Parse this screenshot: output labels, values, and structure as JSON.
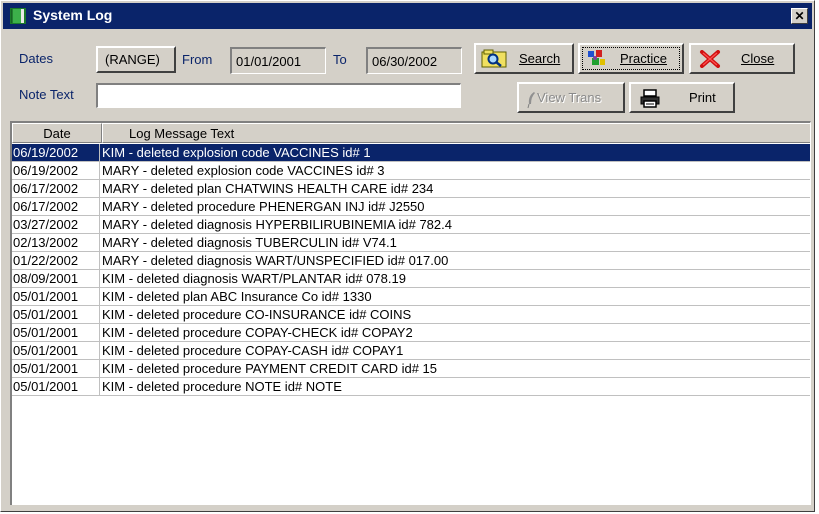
{
  "window": {
    "title": "System Log",
    "close_glyph": "✕",
    "title_icon": "book-icon"
  },
  "filters": {
    "dates_label": "Dates",
    "range_button": "(RANGE)",
    "from_label": "From",
    "from_value": "01/01/2001",
    "to_label": "To",
    "to_value": "06/30/2002",
    "note_label": "Note Text",
    "note_value": ""
  },
  "buttons": {
    "search": {
      "label": "Search",
      "icon": "search-icon"
    },
    "practice": {
      "label": "Practice",
      "icon": "practice-icon"
    },
    "close": {
      "label": "Close",
      "icon": "close-x-icon"
    },
    "view_trans": {
      "label": "View Trans",
      "icon": "quill-icon",
      "disabled": true
    },
    "print": {
      "label": "Print",
      "icon": "printer-icon"
    }
  },
  "log": {
    "columns": [
      "Date",
      "Log Message Text"
    ],
    "selected_index": 0,
    "rows": [
      {
        "date": "06/19/2002",
        "text": "KIM - deleted explosion code VACCINES id# 1"
      },
      {
        "date": "06/19/2002",
        "text": "MARY - deleted explosion code VACCINES id# 3"
      },
      {
        "date": "06/17/2002",
        "text": "MARY - deleted plan CHATWINS HEALTH CARE id# 234"
      },
      {
        "date": "06/17/2002",
        "text": "MARY - deleted procedure PHENERGAN INJ id# J2550"
      },
      {
        "date": "03/27/2002",
        "text": "MARY - deleted diagnosis HYPERBILIRUBINEMIA id# 782.4"
      },
      {
        "date": "02/13/2002",
        "text": "MARY - deleted diagnosis TUBERCULIN id# V74.1"
      },
      {
        "date": "01/22/2002",
        "text": "MARY - deleted diagnosis WART/UNSPECIFIED id# 017.00"
      },
      {
        "date": "08/09/2001",
        "text": "KIM - deleted diagnosis WART/PLANTAR id# 078.19"
      },
      {
        "date": "05/01/2001",
        "text": "KIM - deleted plan ABC Insurance Co id# 1330"
      },
      {
        "date": "05/01/2001",
        "text": "KIM - deleted procedure CO-INSURANCE id# COINS"
      },
      {
        "date": "05/01/2001",
        "text": "KIM - deleted procedure COPAY-CHECK id# COPAY2"
      },
      {
        "date": "05/01/2001",
        "text": "KIM - deleted procedure COPAY-CASH id# COPAY1"
      },
      {
        "date": "05/01/2001",
        "text": "KIM - deleted procedure PAYMENT CREDIT CARD id# 15"
      },
      {
        "date": "05/01/2001",
        "text": "KIM - deleted procedure NOTE id# NOTE"
      }
    ]
  },
  "colors": {
    "title_bar": "#0a246a",
    "face": "#d4d0c8",
    "selection": "#0a246a",
    "label": "#0a246a"
  }
}
